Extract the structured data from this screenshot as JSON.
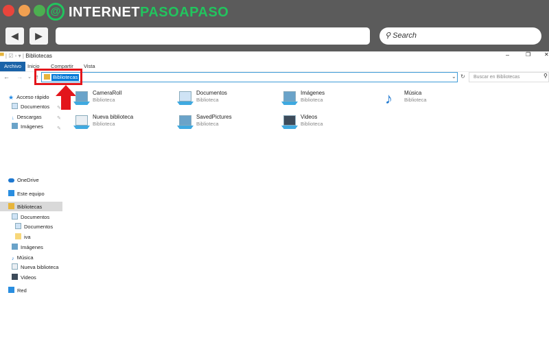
{
  "browser": {
    "brand_white": "INTERNET",
    "brand_green": "PASOAPASO",
    "search_placeholder": "Search",
    "back": "◀",
    "forward": "▶"
  },
  "window": {
    "title": "Bibliotecas",
    "minimize": "–",
    "restore": "❐",
    "close": "✕"
  },
  "ribbon": {
    "tabs": [
      "Archivo",
      "Inicio",
      "Compartir",
      "Vista"
    ]
  },
  "address": {
    "path": "Bibliotecas",
    "search_placeholder": "Buscar en Bibliotecas"
  },
  "sidebar": {
    "quick": [
      {
        "label": "Acceso rápido"
      },
      {
        "label": "Documentos"
      },
      {
        "label": "Descargas"
      },
      {
        "label": "Imágenes"
      }
    ],
    "tree": [
      {
        "label": "OneDrive"
      },
      {
        "label": "Este equipo"
      },
      {
        "label": "Bibliotecas",
        "selected": true
      },
      {
        "label": "Documentos"
      },
      {
        "label": "Documentos"
      },
      {
        "label": "iva"
      },
      {
        "label": "Imágenes"
      },
      {
        "label": "Música"
      },
      {
        "label": "Nueva biblioteca"
      },
      {
        "label": "Videos"
      },
      {
        "label": "Red"
      }
    ]
  },
  "libraries": [
    {
      "name": "CameraRoll",
      "type": "Biblioteca"
    },
    {
      "name": "Documentos",
      "type": "Biblioteca"
    },
    {
      "name": "Imágenes",
      "type": "Biblioteca"
    },
    {
      "name": "Música",
      "type": "Biblioteca"
    },
    {
      "name": "Nueva biblioteca",
      "type": "Biblioteca"
    },
    {
      "name": "SavedPictures",
      "type": "Biblioteca"
    },
    {
      "name": "Videos",
      "type": "Biblioteca"
    }
  ],
  "colors": {
    "accent": "#0078d7",
    "highlight": "#e3151b",
    "brand_green": "#22c45e"
  }
}
